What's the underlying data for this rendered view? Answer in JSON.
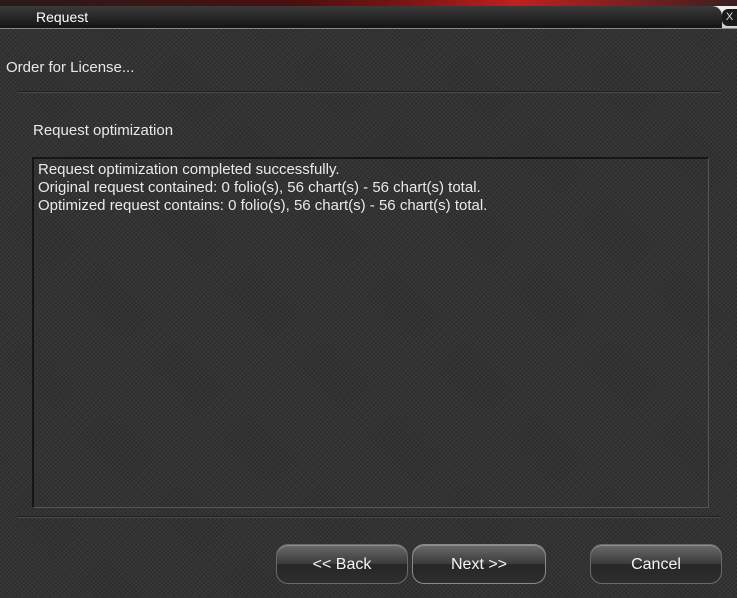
{
  "window": {
    "title": "Request",
    "close_label": "X"
  },
  "wizard": {
    "step_title": "Order for License..."
  },
  "section": {
    "label": "Request optimization"
  },
  "log": {
    "lines": [
      "Request optimization completed successfully.",
      "Original request contained: 0 folio(s), 56 chart(s) - 56 chart(s) total.",
      "Optimized request contains: 0 folio(s), 56 chart(s) - 56 chart(s) total."
    ]
  },
  "buttons": {
    "back": "<< Back",
    "next": "Next >>",
    "cancel": "Cancel"
  }
}
